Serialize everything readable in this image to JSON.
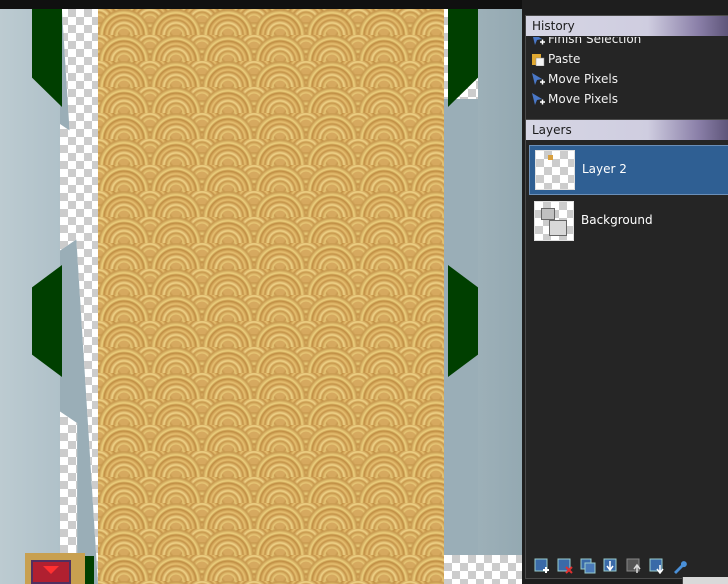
{
  "history": {
    "title": "History",
    "items": [
      {
        "label": "Finish Selection",
        "icon": "selection-icon"
      },
      {
        "label": "Paste",
        "icon": "paste-icon"
      },
      {
        "label": "Move Pixels",
        "icon": "move-icon"
      },
      {
        "label": "Move Pixels",
        "icon": "move-icon"
      }
    ]
  },
  "layers": {
    "title": "Layers",
    "items": [
      {
        "label": "Layer 2",
        "selected": true
      },
      {
        "label": "Background",
        "selected": false
      }
    ],
    "toolbar": [
      "add-layer-icon",
      "delete-layer-icon",
      "duplicate-layer-icon",
      "merge-down-icon",
      "move-layer-up-icon",
      "move-layer-down-icon",
      "layer-properties-icon"
    ]
  },
  "colors": {
    "selection": "#2f5f93",
    "panel_bg": "#252525",
    "notch_green": "#003f00",
    "mosaic": "#d6a95f"
  }
}
